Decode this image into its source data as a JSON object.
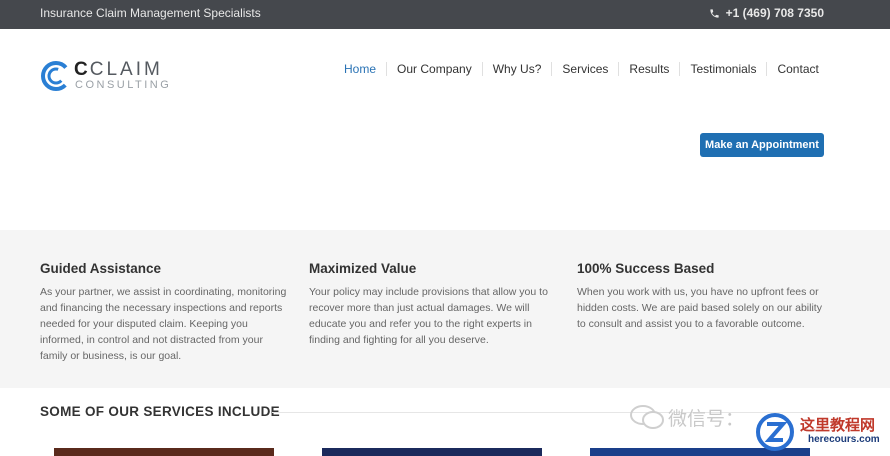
{
  "topbar": {
    "tagline": "Insurance Claim Management Specialists",
    "phone": "+1 (469) 708 7350",
    "phone_icon": "phone-icon"
  },
  "logo": {
    "brand_bold": "C",
    "brand_rest": "CLAIM",
    "sub": "CONSULTING",
    "mark_color": "#2a7fd4"
  },
  "nav": {
    "items": [
      {
        "label": "Home",
        "active": true
      },
      {
        "label": "Our Company"
      },
      {
        "label": "Why Us?"
      },
      {
        "label": "Services"
      },
      {
        "label": "Results"
      },
      {
        "label": "Testimonials"
      },
      {
        "label": "Contact"
      }
    ],
    "active_color": "#2a73b5"
  },
  "cta": {
    "label": "Make an Appointment",
    "color": "#1f6fb2"
  },
  "features": [
    {
      "title": "Guided Assistance",
      "text": "As your partner, we assist in coordinating, monitoring and financing the necessary inspections and reports needed for your disputed claim. Keeping you informed, in control and not distracted from your family or business, is our goal."
    },
    {
      "title": "Maximized Value",
      "text": "Your policy may include provisions that allow you to recover more than just actual damages. We will educate you and refer you to the right experts in finding and fighting for all you deserve."
    },
    {
      "title": "100% Success Based",
      "text": "When you work with us, you have no upfront fees or hidden costs. We are paid based solely on our ability to consult and assist you to a favorable outcome."
    }
  ],
  "services": {
    "heading": "SOME OF OUR SERVICES INCLUDE",
    "thumb_colors": [
      "#5a2a1c",
      "#1b2a5c",
      "#1a3f8a"
    ]
  },
  "watermark": {
    "text": "微信号：",
    "cn": "这里教程网",
    "url": "herecours.com"
  }
}
